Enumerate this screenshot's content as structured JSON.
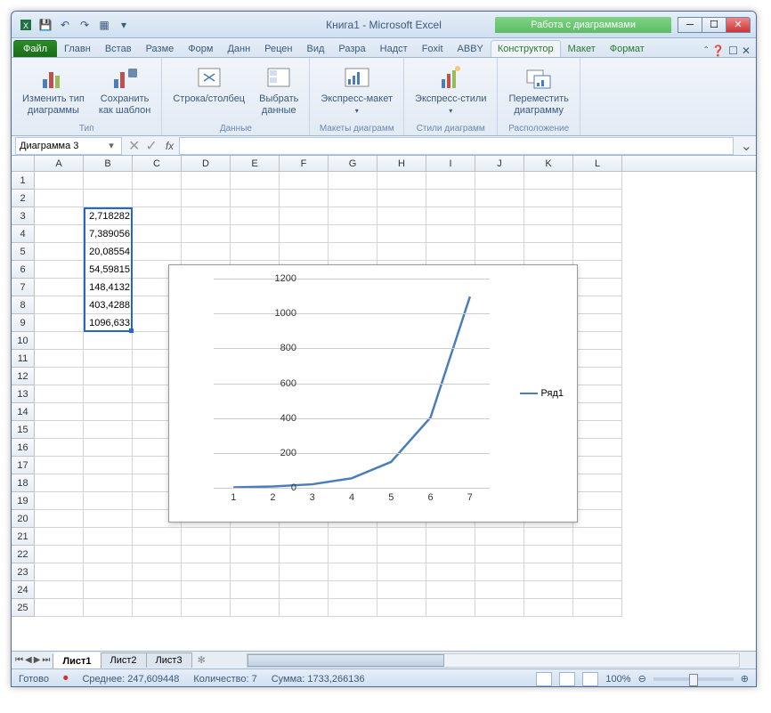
{
  "titlebar": {
    "doc_title": "Книга1 - Microsoft Excel",
    "chart_tools": "Работа с диаграммами"
  },
  "tabs": {
    "file": "Файл",
    "items": [
      "Главн",
      "Встав",
      "Разме",
      "Форм",
      "Данн",
      "Рецен",
      "Вид",
      "Разра",
      "Надст",
      "Foxit",
      "ABBY"
    ],
    "chart_tabs": [
      "Конструктор",
      "Макет",
      "Формат"
    ]
  },
  "ribbon": {
    "groups": [
      {
        "label": "Тип",
        "buttons": [
          "Изменить тип\nдиаграммы",
          "Сохранить\nкак шаблон"
        ]
      },
      {
        "label": "Данные",
        "buttons": [
          "Строка/столбец",
          "Выбрать\nданные"
        ]
      },
      {
        "label": "Макеты диаграмм",
        "buttons": [
          "Экспресс-макет"
        ]
      },
      {
        "label": "Стили диаграмм",
        "buttons": [
          "Экспресс-стили"
        ]
      },
      {
        "label": "Расположение",
        "buttons": [
          "Переместить\nдиаграмму"
        ]
      }
    ]
  },
  "name_box": "Диаграмма 3",
  "columns": [
    "A",
    "B",
    "C",
    "D",
    "E",
    "F",
    "G",
    "H",
    "I",
    "J",
    "K",
    "L"
  ],
  "rows": 25,
  "data_cells": {
    "b3": "2,718282",
    "b4": "7,389056",
    "b5": "20,08554",
    "b6": "54,59815",
    "b7": "148,4132",
    "b8": "403,4288",
    "b9": "1096,633"
  },
  "chart_data": {
    "type": "line",
    "x": [
      1,
      2,
      3,
      4,
      5,
      6,
      7
    ],
    "series": [
      {
        "name": "Ряд1",
        "values": [
          2.718282,
          7.389056,
          20.08554,
          54.59815,
          148.4132,
          403.4288,
          1096.633
        ]
      }
    ],
    "ylim": [
      0,
      1200
    ],
    "yticks": [
      0,
      200,
      400,
      600,
      800,
      1000,
      1200
    ],
    "xticks": [
      1,
      2,
      3,
      4,
      5,
      6,
      7
    ],
    "legend": "Ряд1"
  },
  "sheet_tabs": [
    "Лист1",
    "Лист2",
    "Лист3"
  ],
  "status": {
    "ready": "Готово",
    "avg_label": "Среднее:",
    "avg": "247,609448",
    "count_label": "Количество:",
    "count": "7",
    "sum_label": "Сумма:",
    "sum": "1733,266136",
    "zoom": "100%"
  }
}
